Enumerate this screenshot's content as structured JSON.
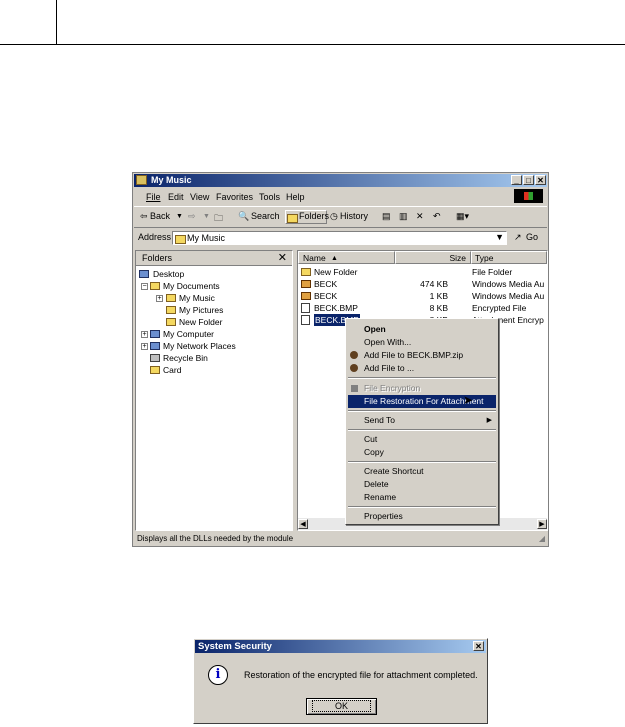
{
  "window": {
    "title": "My Music",
    "menu": [
      "File",
      "Edit",
      "View",
      "Favorites",
      "Tools",
      "Help"
    ],
    "toolbar": {
      "back": "Back",
      "search": "Search",
      "folders": "Folders",
      "history": "History"
    },
    "address": {
      "label": "Address",
      "value": "My Music",
      "go": "Go"
    },
    "folders_panel": {
      "title": "Folders",
      "close": "✕",
      "tree": [
        "Desktop",
        "My Documents",
        "My Music",
        "My Pictures",
        "New Folder",
        "My Computer",
        "My Network Places",
        "Recycle Bin",
        "Card"
      ]
    },
    "columns": {
      "name": "Name",
      "size": "Size",
      "type": "Type"
    },
    "files": [
      {
        "name": "New Folder",
        "size": "",
        "type": "File Folder",
        "icon": "folder-icon"
      },
      {
        "name": "BECK",
        "size": "474 KB",
        "type": "Windows Media Au",
        "icon": "audio-file-icon"
      },
      {
        "name": "BECK",
        "size": "1 KB",
        "type": "Windows Media Au",
        "icon": "audio-file-icon"
      },
      {
        "name": "BECK.BMP",
        "size": "8 KB",
        "type": "Encrypted File",
        "icon": "encrypted-file-icon"
      },
      {
        "name": "BECK.BMP",
        "size": "8 KB",
        "type": "Attachment Encryp",
        "icon": "attachment-file-icon"
      }
    ],
    "status": "Displays all the DLLs needed by the module"
  },
  "context_menu": {
    "items": [
      {
        "label": "Open",
        "bold": true
      },
      {
        "label": "Open With..."
      },
      {
        "label": "Add File to BECK.BMP.zip",
        "icon": "zip-icon"
      },
      {
        "label": "Add File to ...",
        "icon": "zip-icon"
      },
      {
        "label": "File Encryption",
        "disabled": true
      },
      {
        "label": "File Restoration For Attachment",
        "selected": true
      },
      {
        "label": "Send To",
        "submenu": true
      },
      {
        "label": "Cut"
      },
      {
        "label": "Copy"
      },
      {
        "label": "Create Shortcut"
      },
      {
        "label": "Delete"
      },
      {
        "label": "Rename"
      },
      {
        "label": "Properties"
      }
    ]
  },
  "dialog": {
    "title": "System Security",
    "message": "Restoration of the encrypted file for attachment completed.",
    "ok": "OK",
    "close": "✕"
  },
  "colors": {
    "titlebar_start": "#0a246a",
    "titlebar_end": "#a6caf0",
    "chrome": "#d4d0c8",
    "selection": "#0a246a"
  }
}
